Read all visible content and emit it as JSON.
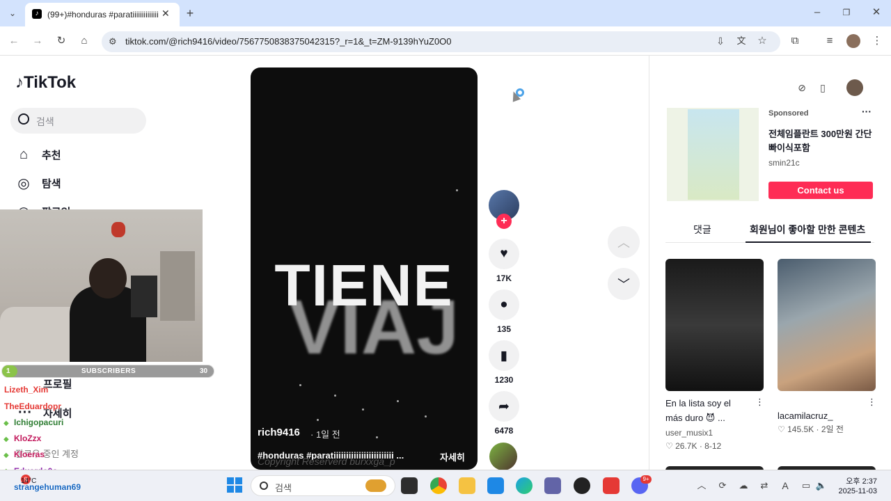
{
  "browser": {
    "tab_title": "(99+)#honduras #paratiiiiiiiiiiiiiii",
    "url": "tiktok.com/@rich9416/video/7567750838375042315?_r=1&_t=ZM-9139hYuZ0O0"
  },
  "tiktok": {
    "logo": "TikTok",
    "search_placeholder": "검색",
    "nav": {
      "home": "추천",
      "explore": "탐색",
      "following": "팔로잉",
      "profile": "프로필",
      "more": "자세히",
      "following_accounts": "팔로우 중인 계정"
    }
  },
  "video": {
    "overlay_text": "TIENE",
    "ghost_text": "VIAJ",
    "author": "rich9416",
    "posted": "· 1일 전",
    "caption": "#honduras #paratiiiiiiiiiiiiiiiiiiiiiiii ...",
    "more_label": "자세히",
    "watermark": "Copyright Reserverd burxxga_p"
  },
  "actions": {
    "likes": "17K",
    "comments": "135",
    "saves": "1230",
    "shares": "6478"
  },
  "ad": {
    "sponsored": "Sponsored",
    "title": "전체임플란트 300만원 간단 빠이식포함",
    "handle": "smin21c",
    "cta": "Contact us"
  },
  "right_tabs": {
    "comments": "댓글",
    "recommended": "회원님이 좋아할 만한 콘텐츠"
  },
  "recommendations": [
    {
      "title_line1": "En la lista soy el",
      "title_line2": "más duro 😈 ...",
      "user": "user_musix1",
      "likes": "26.7K",
      "date": "8-12"
    },
    {
      "title_line1": "lacamilacruz_",
      "title_line2": "",
      "user": "",
      "likes": "145.5K",
      "date": "2일 전"
    }
  ],
  "overlay": {
    "subs_label": "SUBSCRIBERS",
    "subs_current": "1",
    "subs_goal": "30",
    "chat_users": [
      "Lizeth_Xim",
      "TheEduardopr",
      "Ichigopacuri",
      "KloZzx",
      "Kloeras",
      "Eduardo0o",
      "strangehuman69"
    ],
    "chat_colors": [
      "#e53935",
      "#e53935",
      "#2e7d32",
      "#c2185b",
      "#c2185b",
      "#8e24aa",
      "#1565c0"
    ]
  },
  "taskbar": {
    "search_placeholder": "검색",
    "weather_temp": "14°C",
    "notification_badge": "9",
    "discord_badge": "9+",
    "clock_time": "오후 2:37",
    "clock_date": "2025-11-03"
  }
}
